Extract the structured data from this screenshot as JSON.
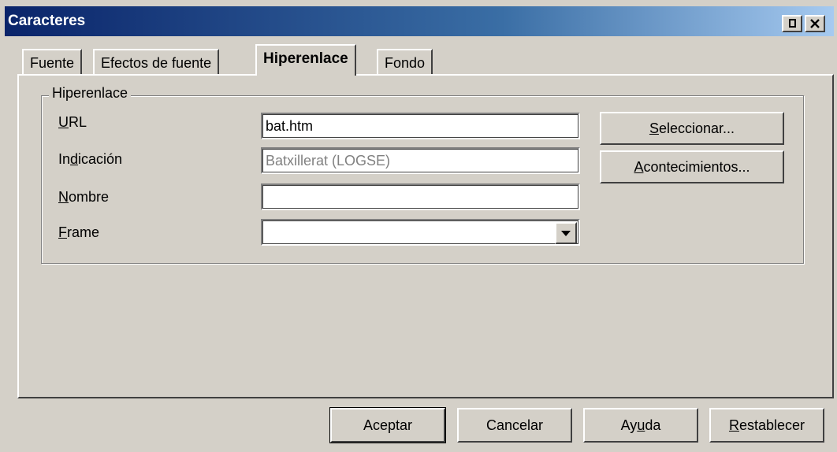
{
  "window": {
    "title": "Caracteres"
  },
  "tabs": [
    {
      "label": "Fuente"
    },
    {
      "label": "Efectos de fuente"
    },
    {
      "label": "Hiperenlace"
    },
    {
      "label": "Fondo"
    }
  ],
  "active_tab": "Hiperenlace",
  "group": {
    "legend": "Hiperenlace",
    "fields": {
      "url": {
        "label": "URL",
        "value": "bat.htm"
      },
      "indicacion": {
        "label": "Indicación",
        "value": "Batxillerat (LOGSE)"
      },
      "nombre": {
        "label": "Nombre",
        "value": ""
      },
      "frame": {
        "label": "Frame",
        "value": ""
      }
    },
    "buttons": {
      "select": "Seleccionar...",
      "events": "Acontecimientos..."
    }
  },
  "footer": {
    "ok": "Aceptar",
    "cancel": "Cancelar",
    "help": "Ayuda",
    "reset": "Restablecer"
  },
  "icons": [
    "help-icon",
    "close-icon",
    "dropdown-arrow-icon"
  ],
  "colors": {
    "titlebar_start": "#0a246a",
    "titlebar_end": "#a6caf0",
    "face": "#d4d0c8"
  }
}
